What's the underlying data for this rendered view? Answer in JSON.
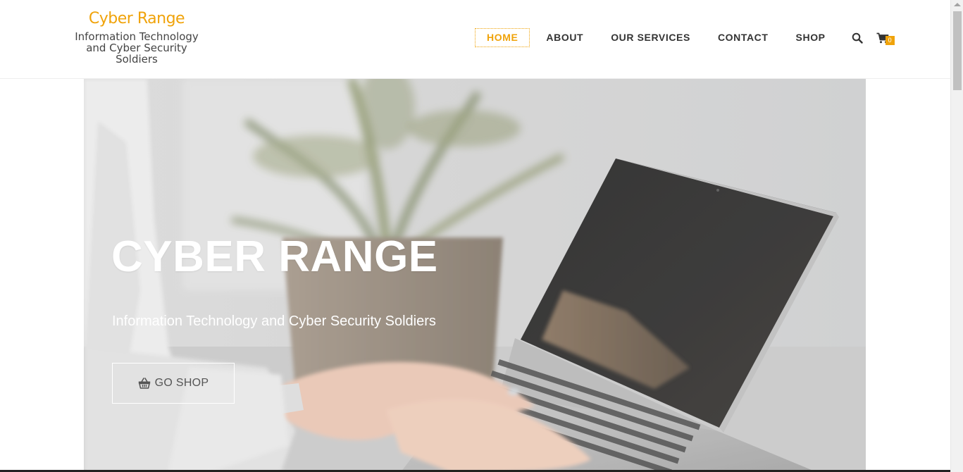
{
  "brand": {
    "title": "Cyber Range",
    "tagline": "Information Technology and Cyber Security Soldiers"
  },
  "nav": {
    "items": [
      {
        "label": "HOME",
        "active": true
      },
      {
        "label": "ABOUT",
        "active": false
      },
      {
        "label": "OUR SERVICES",
        "active": false
      },
      {
        "label": "CONTACT",
        "active": false
      },
      {
        "label": "SHOP",
        "active": false
      }
    ],
    "search_icon": "search-icon",
    "cart_icon": "shopping-cart-icon",
    "cart_count": "0"
  },
  "hero": {
    "title": "CYBER RANGE",
    "subtitle": "Information Technology and Cyber Security Soldiers",
    "button_label": "GO SHOP",
    "button_icon": "shopping-basket-icon"
  },
  "colors": {
    "accent": "#f0a30a",
    "nav_text": "#333333",
    "hero_text": "#ffffff"
  }
}
